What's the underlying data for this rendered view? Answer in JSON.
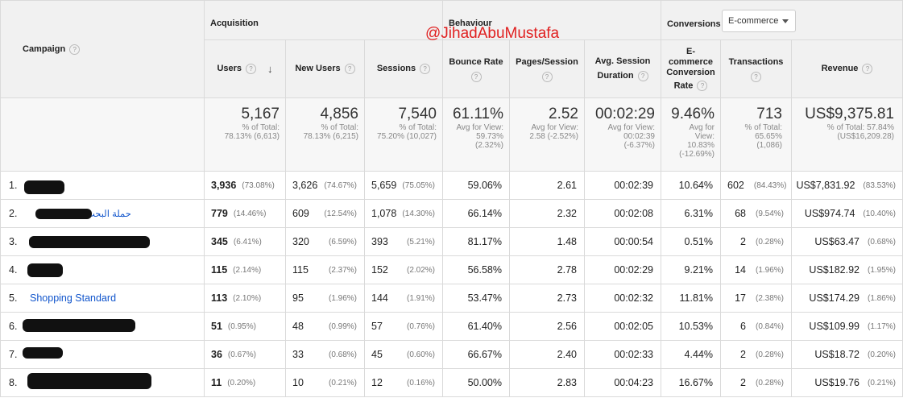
{
  "header": {
    "campaign_label": "Campaign",
    "groups": {
      "acquisition": "Acquisition",
      "behaviour": "Behaviour",
      "conversions": "Conversions"
    },
    "conversions_select": "E-commerce",
    "watermark": "@JihadAbuMustafa",
    "columns": {
      "users": "Users",
      "new_users": "New Users",
      "sessions": "Sessions",
      "bounce_rate": "Bounce Rate",
      "pages_session": "Pages/Session",
      "avg_session_duration_1": "Avg. Session",
      "avg_session_duration_2": "Duration",
      "ecom_rate_1": "E-",
      "ecom_rate_2": "commerce",
      "ecom_rate_3": "Conversion",
      "ecom_rate_4": "Rate",
      "transactions": "Transactions",
      "revenue": "Revenue"
    },
    "help_glyph": "?",
    "sort_glyph": "↓"
  },
  "totals": {
    "users": {
      "value": "5,167",
      "l1": "% of Total:",
      "l2": "78.13% (6,613)"
    },
    "new_users": {
      "value": "4,856",
      "l1": "% of Total:",
      "l2": "78.13% (6,215)"
    },
    "sessions": {
      "value": "7,540",
      "l1": "% of Total:",
      "l2": "75.20% (10,027)"
    },
    "bounce_rate": {
      "value": "61.11%",
      "l1": "Avg for View:",
      "l2": "59.73%",
      "l3": "(2.32%)"
    },
    "pages_session": {
      "value": "2.52",
      "l1": "Avg for View:",
      "l2": "2.58 (-2.52%)"
    },
    "avg_duration": {
      "value": "00:02:29",
      "l1": "Avg for View:",
      "l2": "00:02:39",
      "l3": "(-6.37%)"
    },
    "ecom_rate": {
      "value": "9.46%",
      "l1": "Avg for",
      "l2": "View:",
      "l3": "10.83%",
      "l4": "(-12.69%)"
    },
    "transactions": {
      "value": "713",
      "l1": "% of Total:",
      "l2": "65.65%",
      "l3": "(1,086)"
    },
    "revenue": {
      "value": "US$9,375.81",
      "l1": "% of Total: 57.84%",
      "l2": "(US$16,209.28)"
    }
  },
  "rows": [
    {
      "idx": "1.",
      "name": "",
      "users": "3,936",
      "users_pct": "(73.08%)",
      "new_users": "3,626",
      "new_users_pct": "(74.67%)",
      "sessions": "5,659",
      "sessions_pct": "(75.05%)",
      "bounce": "59.06%",
      "pages": "2.61",
      "duration": "00:02:39",
      "ecom": "10.64%",
      "trans": "602",
      "trans_pct": "(84.43%)",
      "revenue": "US$7,831.92",
      "revenue_pct": "(83.53%)"
    },
    {
      "idx": "2.",
      "name": "حملة البحث",
      "users": "779",
      "users_pct": "(14.46%)",
      "new_users": "609",
      "new_users_pct": "(12.54%)",
      "sessions": "1,078",
      "sessions_pct": "(14.30%)",
      "bounce": "66.14%",
      "pages": "2.32",
      "duration": "00:02:08",
      "ecom": "6.31%",
      "trans": "68",
      "trans_pct": "(9.54%)",
      "revenue": "US$974.74",
      "revenue_pct": "(10.40%)"
    },
    {
      "idx": "3.",
      "name": "",
      "users": "345",
      "users_pct": "(6.41%)",
      "new_users": "320",
      "new_users_pct": "(6.59%)",
      "sessions": "393",
      "sessions_pct": "(5.21%)",
      "bounce": "81.17%",
      "pages": "1.48",
      "duration": "00:00:54",
      "ecom": "0.51%",
      "trans": "2",
      "trans_pct": "(0.28%)",
      "revenue": "US$63.47",
      "revenue_pct": "(0.68%)"
    },
    {
      "idx": "4.",
      "name": "",
      "users": "115",
      "users_pct": "(2.14%)",
      "new_users": "115",
      "new_users_pct": "(2.37%)",
      "sessions": "152",
      "sessions_pct": "(2.02%)",
      "bounce": "56.58%",
      "pages": "2.78",
      "duration": "00:02:29",
      "ecom": "9.21%",
      "trans": "14",
      "trans_pct": "(1.96%)",
      "revenue": "US$182.92",
      "revenue_pct": "(1.95%)"
    },
    {
      "idx": "5.",
      "name": "Shopping Standard",
      "users": "113",
      "users_pct": "(2.10%)",
      "new_users": "95",
      "new_users_pct": "(1.96%)",
      "sessions": "144",
      "sessions_pct": "(1.91%)",
      "bounce": "53.47%",
      "pages": "2.73",
      "duration": "00:02:32",
      "ecom": "11.81%",
      "trans": "17",
      "trans_pct": "(2.38%)",
      "revenue": "US$174.29",
      "revenue_pct": "(1.86%)"
    },
    {
      "idx": "6.",
      "name": "",
      "users": "51",
      "users_pct": "(0.95%)",
      "new_users": "48",
      "new_users_pct": "(0.99%)",
      "sessions": "57",
      "sessions_pct": "(0.76%)",
      "bounce": "61.40%",
      "pages": "2.56",
      "duration": "00:02:05",
      "ecom": "10.53%",
      "trans": "6",
      "trans_pct": "(0.84%)",
      "revenue": "US$109.99",
      "revenue_pct": "(1.17%)"
    },
    {
      "idx": "7.",
      "name": "",
      "users": "36",
      "users_pct": "(0.67%)",
      "new_users": "33",
      "new_users_pct": "(0.68%)",
      "sessions": "45",
      "sessions_pct": "(0.60%)",
      "bounce": "66.67%",
      "pages": "2.40",
      "duration": "00:02:33",
      "ecom": "4.44%",
      "trans": "2",
      "trans_pct": "(0.28%)",
      "revenue": "US$18.72",
      "revenue_pct": "(0.20%)"
    },
    {
      "idx": "8.",
      "name": "",
      "users": "11",
      "users_pct": "(0.20%)",
      "new_users": "10",
      "new_users_pct": "(0.21%)",
      "sessions": "12",
      "sessions_pct": "(0.16%)",
      "bounce": "50.00%",
      "pages": "2.83",
      "duration": "00:04:23",
      "ecom": "16.67%",
      "trans": "2",
      "trans_pct": "(0.28%)",
      "revenue": "US$19.76",
      "revenue_pct": "(0.21%)"
    }
  ]
}
